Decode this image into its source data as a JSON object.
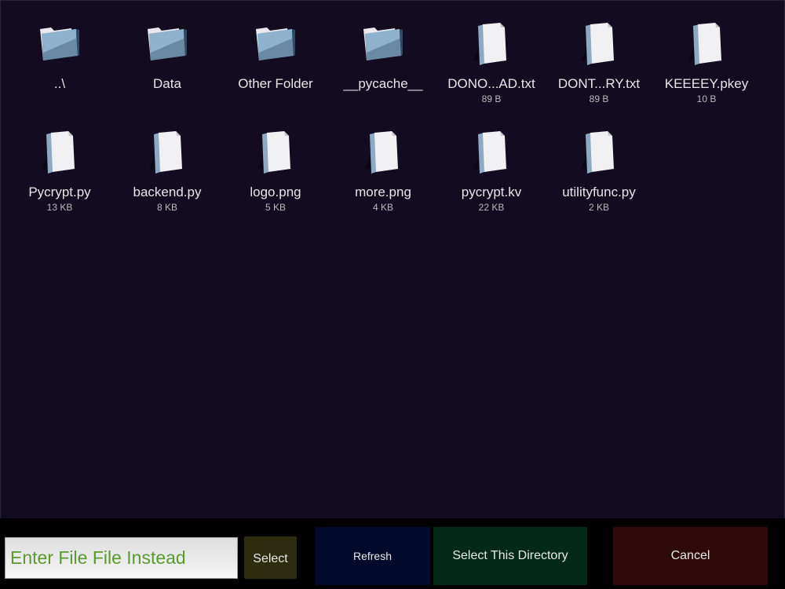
{
  "browser": {
    "items": [
      {
        "type": "folder",
        "name": "..\\",
        "size": ""
      },
      {
        "type": "folder",
        "name": "Data",
        "size": ""
      },
      {
        "type": "folder",
        "name": "Other Folder",
        "size": ""
      },
      {
        "type": "folder",
        "name": "__pycache__",
        "size": ""
      },
      {
        "type": "file",
        "name": "DONO...AD.txt",
        "size": "89 B"
      },
      {
        "type": "file",
        "name": "DONT...RY.txt",
        "size": "89 B"
      },
      {
        "type": "file",
        "name": "KEEEEY.pkey",
        "size": "10 B"
      },
      {
        "type": "file",
        "name": "Pycrypt.py",
        "size": "13 KB"
      },
      {
        "type": "file",
        "name": "backend.py",
        "size": "8 KB"
      },
      {
        "type": "file",
        "name": "logo.png",
        "size": "5 KB"
      },
      {
        "type": "file",
        "name": "more.png",
        "size": "4 KB"
      },
      {
        "type": "file",
        "name": "pycrypt.kv",
        "size": "22 KB"
      },
      {
        "type": "file",
        "name": "utilityfunc.py",
        "size": "2 KB"
      }
    ]
  },
  "footer": {
    "file_input_value": "Enter File File Instead",
    "select_label": "Select",
    "refresh_label": "Refresh",
    "select_dir_label": "Select This Directory",
    "cancel_label": "Cancel"
  }
}
